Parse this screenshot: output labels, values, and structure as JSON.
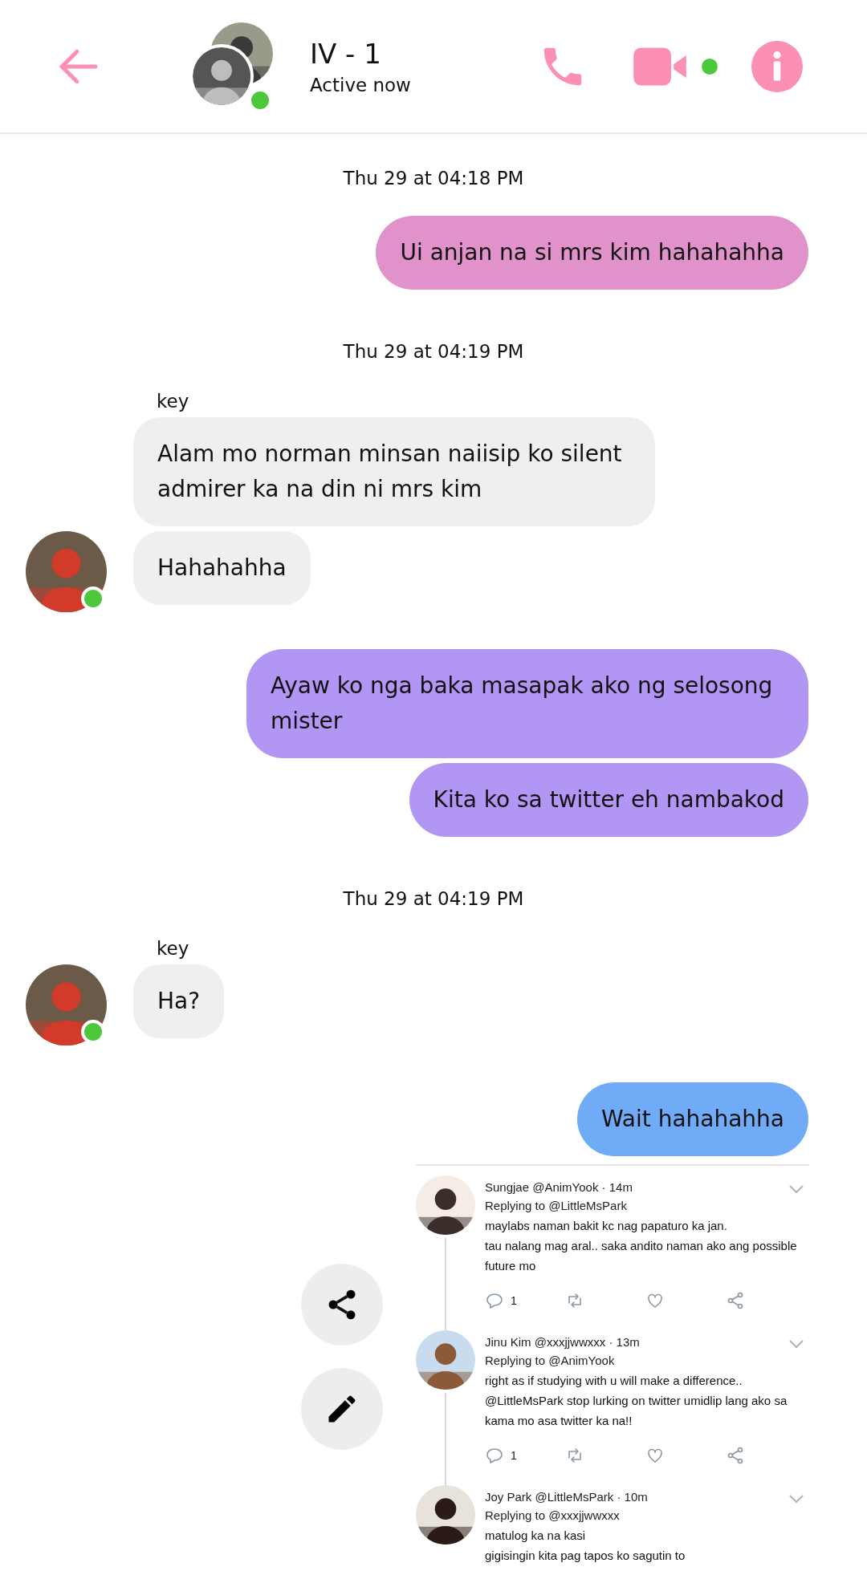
{
  "header": {
    "title": "IV - 1",
    "subtitle": "Active now",
    "online": true,
    "video_online": true
  },
  "messages": [
    {
      "kind": "timestamp",
      "text": "Thu 29 at 04:18 PM"
    },
    {
      "kind": "outgoing",
      "text": "Ui anjan na si mrs kim hahahahha",
      "color": "#e292ca"
    },
    {
      "kind": "timestamp",
      "text": "Thu 29 at 04:19 PM"
    },
    {
      "kind": "sender",
      "text": "key"
    },
    {
      "kind": "incoming",
      "text": "Alam mo norman minsan naiisip ko silent admirer ka na din ni mrs kim",
      "color": "#efefef",
      "show_avatar": false
    },
    {
      "kind": "incoming",
      "text": "Hahahahha",
      "color": "#efefef",
      "show_avatar": true,
      "online": true
    },
    {
      "kind": "outgoing",
      "text": "Ayaw ko nga baka masapak ako ng selosong mister",
      "color": "#b196f4"
    },
    {
      "kind": "outgoing",
      "text": "Kita ko sa twitter eh nambakod",
      "color": "#b196f4"
    },
    {
      "kind": "timestamp",
      "text": "Thu 29 at 04:19 PM"
    },
    {
      "kind": "sender",
      "text": "key"
    },
    {
      "kind": "incoming",
      "text": "Ha?",
      "color": "#efefef",
      "show_avatar": true,
      "online": true
    },
    {
      "kind": "outgoing",
      "text": "Wait hahahahha",
      "color": "#70abf7"
    },
    {
      "kind": "shared_image",
      "tweets": [
        {
          "author": "Sungjae @AnimYook · 14m",
          "replying": "Replying to @LittleMsPark",
          "text": "maylabs naman bakit kc nag papaturo ka jan.\ntau nalang mag aral.. saka andito naman ako ang possible future mo",
          "replies": "1"
        },
        {
          "author": "Jinu Kim @xxxjjwwxxx · 13m",
          "replying": "Replying to @AnimYook",
          "text": "right as if studying with u will make a difference..\n@LittleMsPark stop lurking on twitter umidlip lang ako sa kama mo asa twitter ka na!!",
          "replies": "1"
        },
        {
          "author": "Joy Park @LittleMsPark · 10m",
          "replying": "Replying to @xxxjjwwxxx",
          "text": "matulog ka na kasi\ngigisingin kita pag tapos ko sagutin to"
        }
      ]
    }
  ],
  "fabs": [
    {
      "kind": "share"
    },
    {
      "kind": "edit"
    }
  ]
}
